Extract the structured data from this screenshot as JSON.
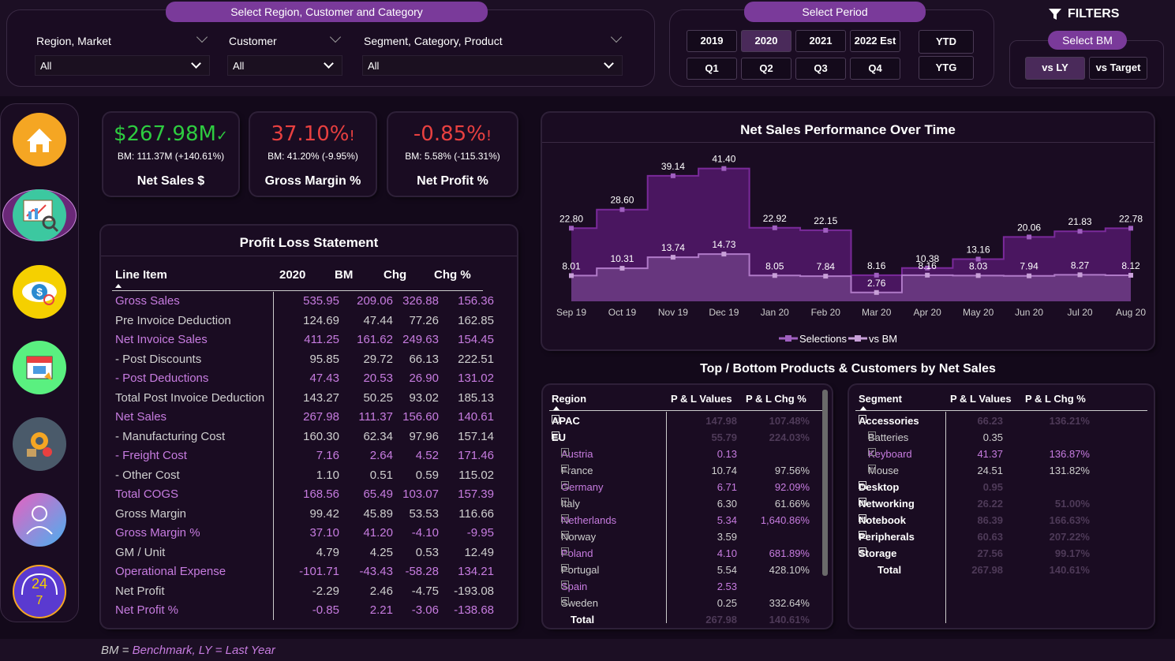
{
  "filters_header": {
    "region_customer_category_title": "Select Region, Customer and Category",
    "region_label": "Region, Market",
    "region_value": "All",
    "customer_label": "Customer",
    "customer_value": "All",
    "segment_label": "Segment, Category, Product",
    "segment_value": "All",
    "period_title": "Select Period",
    "years": [
      "2019",
      "2020",
      "2021",
      "2022 Est"
    ],
    "selected_year": "2020",
    "quarters": [
      "Q1",
      "Q2",
      "Q3",
      "Q4"
    ],
    "ytd": "YTD",
    "ytg": "YTG",
    "filters_label": "FILTERS",
    "bm_title": "Select BM",
    "vs_ly": "vs LY",
    "vs_target": "vs Target"
  },
  "sidebar": {
    "items": [
      "home-icon",
      "analytics-presentation-icon",
      "eye-dollar-icon",
      "store-icon",
      "supply-chain-icon",
      "user-icon",
      "support-24-7-icon"
    ]
  },
  "kpis": [
    {
      "value": "$267.98M",
      "indicator": "✓",
      "bm": "BM: 111.37M (+140.61%)",
      "name": "Net Sales $",
      "color": "#2ecc40"
    },
    {
      "value": "37.10%",
      "indicator": "!",
      "bm": "BM: 41.20% (-9.95%)",
      "name": "Gross Margin %",
      "color": "#e84040"
    },
    {
      "value": "-0.85%",
      "indicator": "!",
      "bm": "BM: 5.58% (-115.31%)",
      "name": "Net Profit %",
      "color": "#e84040"
    }
  ],
  "pl_statement": {
    "title": "Profit Loss Statement",
    "headers": [
      "Line Item",
      "2020",
      "BM",
      "Chg",
      "Chg %"
    ],
    "rows": [
      {
        "item": "Gross Sales",
        "v": "535.95",
        "bm": "209.06",
        "chg": "326.88",
        "pct": "156.36",
        "style": "purple"
      },
      {
        "item": "Pre Invoice Deduction",
        "v": "124.69",
        "bm": "47.44",
        "chg": "77.26",
        "pct": "162.85",
        "style": "grey"
      },
      {
        "item": "Net Invoice Sales",
        "v": "411.25",
        "bm": "161.62",
        "chg": "249.63",
        "pct": "154.45",
        "style": "purple"
      },
      {
        "item": "- Post Discounts",
        "v": "95.85",
        "bm": "29.72",
        "chg": "66.13",
        "pct": "222.51",
        "style": "grey"
      },
      {
        "item": "- Post Deductions",
        "v": "47.43",
        "bm": "20.53",
        "chg": "26.90",
        "pct": "131.02",
        "style": "purple"
      },
      {
        "item": "Total Post Invoice Deduction",
        "v": "143.27",
        "bm": "50.25",
        "chg": "93.02",
        "pct": "185.13",
        "style": "grey"
      },
      {
        "item": "Net Sales",
        "v": "267.98",
        "bm": "111.37",
        "chg": "156.60",
        "pct": "140.61",
        "style": "purple"
      },
      {
        "item": "- Manufacturing Cost",
        "v": "160.30",
        "bm": "62.34",
        "chg": "97.96",
        "pct": "157.14",
        "style": "grey"
      },
      {
        "item": "- Freight Cost",
        "v": "7.16",
        "bm": "2.64",
        "chg": "4.52",
        "pct": "171.46",
        "style": "purple"
      },
      {
        "item": "- Other Cost",
        "v": "1.10",
        "bm": "0.51",
        "chg": "0.59",
        "pct": "115.02",
        "style": "grey"
      },
      {
        "item": "Total COGS",
        "v": "168.56",
        "bm": "65.49",
        "chg": "103.07",
        "pct": "157.39",
        "style": "purple"
      },
      {
        "item": "Gross Margin",
        "v": "99.42",
        "bm": "45.89",
        "chg": "53.53",
        "pct": "116.66",
        "style": "grey"
      },
      {
        "item": "Gross Margin %",
        "v": "37.10",
        "bm": "41.20",
        "chg": "-4.10",
        "pct": "-9.95",
        "style": "purple"
      },
      {
        "item": "GM / Unit",
        "v": "4.79",
        "bm": "4.25",
        "chg": "0.53",
        "pct": "12.49",
        "style": "grey"
      },
      {
        "item": "Operational Expense",
        "v": "-101.71",
        "bm": "-43.43",
        "chg": "-58.28",
        "pct": "134.21",
        "style": "purple"
      },
      {
        "item": "Net Profit",
        "v": "-2.29",
        "bm": "2.46",
        "chg": "-4.75",
        "pct": "-193.08",
        "style": "grey"
      },
      {
        "item": "Net Profit %",
        "v": "-0.85",
        "bm": "2.21",
        "chg": "-3.06",
        "pct": "-138.68",
        "style": "purple"
      }
    ]
  },
  "chart_data": {
    "type": "area",
    "title": "Net Sales Performance Over Time",
    "categories": [
      "Sep 19",
      "Oct 19",
      "Nov 19",
      "Dec 19",
      "Jan 20",
      "Feb 20",
      "Mar 20",
      "Apr 20",
      "May 20",
      "Jun 20",
      "Jul 20",
      "Aug 20"
    ],
    "series": [
      {
        "name": "Selections",
        "values": [
          22.8,
          28.6,
          39.14,
          41.4,
          22.92,
          22.15,
          8.16,
          10.38,
          13.16,
          20.06,
          21.83,
          22.78
        ],
        "labels": [
          "22.80",
          "28.60",
          "39.14",
          "41.40",
          "22.92",
          "22.15",
          "8.16",
          "10.38",
          "13.16",
          "20.06",
          "21.83",
          "22.78"
        ],
        "color": "#5e1f78"
      },
      {
        "name": "vs BM",
        "values": [
          8.01,
          10.31,
          13.74,
          14.73,
          8.05,
          7.84,
          2.76,
          8.16,
          8.03,
          7.94,
          8.27,
          8.12
        ],
        "labels": [
          "8.01",
          "10.31",
          "13.74",
          "14.73",
          "8.05",
          "7.84",
          "2.76",
          "8.16",
          "8.03",
          "7.94",
          "8.27",
          "8.12"
        ],
        "color": "#8a5aa0"
      }
    ],
    "ylim": [
      0,
      45
    ],
    "legend": "bottom",
    "step": true
  },
  "top_bottom": {
    "title": "Top / Bottom Products & Customers by Net Sales",
    "region_table": {
      "headers": [
        "Region",
        "P & L Values",
        "P & L Chg %"
      ],
      "rows": [
        {
          "name": "APAC",
          "v": "147.98",
          "chg": "107.48%",
          "level": 0,
          "expanded": false,
          "dim": true
        },
        {
          "name": "EU",
          "v": "55.79",
          "chg": "224.03%",
          "level": 0,
          "expanded": true,
          "dim": true
        },
        {
          "name": "Austria",
          "v": "0.13",
          "chg": "",
          "level": 1,
          "purple": true
        },
        {
          "name": "France",
          "v": "10.74",
          "chg": "97.56%",
          "level": 1
        },
        {
          "name": "Germany",
          "v": "6.71",
          "chg": "92.09%",
          "level": 1,
          "purple": true
        },
        {
          "name": "Italy",
          "v": "6.30",
          "chg": "61.66%",
          "level": 1
        },
        {
          "name": "Netherlands",
          "v": "5.34",
          "chg": "1,640.86%",
          "level": 1,
          "purple": true
        },
        {
          "name": "Norway",
          "v": "3.59",
          "chg": "",
          "level": 1
        },
        {
          "name": "Poland",
          "v": "4.10",
          "chg": "681.89%",
          "level": 1,
          "purple": true
        },
        {
          "name": "Portugal",
          "v": "5.54",
          "chg": "428.10%",
          "level": 1
        },
        {
          "name": "Spain",
          "v": "2.53",
          "chg": "",
          "level": 1,
          "purple": true
        },
        {
          "name": "Sweden",
          "v": "0.25",
          "chg": "332.64%",
          "level": 1
        },
        {
          "name": "Total",
          "v": "267.98",
          "chg": "140.61%",
          "level": -1,
          "dim": true
        }
      ]
    },
    "segment_table": {
      "headers": [
        "Segment",
        "P & L Values",
        "P & L Chg %"
      ],
      "rows": [
        {
          "name": "Accessories",
          "v": "66.23",
          "chg": "136.21%",
          "level": 0,
          "expanded": true,
          "dim": true
        },
        {
          "name": "Batteries",
          "v": "0.35",
          "chg": "",
          "level": 1
        },
        {
          "name": "Keyboard",
          "v": "41.37",
          "chg": "136.87%",
          "level": 1,
          "purple": true
        },
        {
          "name": "Mouse",
          "v": "24.51",
          "chg": "131.82%",
          "level": 1
        },
        {
          "name": "Desktop",
          "v": "0.95",
          "chg": "",
          "level": 0,
          "expanded": false,
          "dim": true
        },
        {
          "name": "Networking",
          "v": "26.22",
          "chg": "51.00%",
          "level": 0,
          "expanded": false,
          "dim": true
        },
        {
          "name": "Notebook",
          "v": "86.39",
          "chg": "166.63%",
          "level": 0,
          "expanded": false,
          "dim": true
        },
        {
          "name": "Peripherals",
          "v": "60.63",
          "chg": "207.22%",
          "level": 0,
          "expanded": false,
          "dim": true
        },
        {
          "name": "Storage",
          "v": "27.56",
          "chg": "99.17%",
          "level": 0,
          "expanded": false,
          "dim": true
        },
        {
          "name": "Total",
          "v": "267.98",
          "chg": "140.61%",
          "level": -1,
          "dim": true
        }
      ]
    }
  },
  "footer": {
    "prefix": "BM = ",
    "text": "Benchmark, LY = Last Year"
  }
}
